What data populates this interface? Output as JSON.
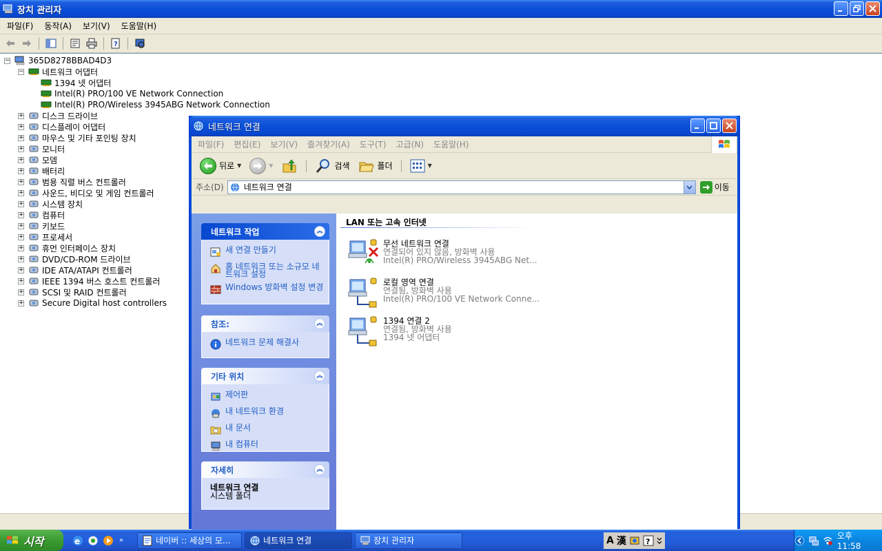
{
  "device_manager": {
    "title": "장치 관리자",
    "menu": [
      "파일(F)",
      "동작(A)",
      "보기(V)",
      "도움말(H)"
    ],
    "tree": {
      "root": "365D8278BBAD4D3",
      "network_adapters": {
        "label": "네트워크 어댑터",
        "children": [
          "1394 넷 어댑터",
          "Intel(R) PRO/100 VE Network Connection",
          "Intel(R) PRO/Wireless 3945ABG Network Connection"
        ]
      },
      "categories": [
        "디스크 드라이브",
        "디스플레이 어댑터",
        "마우스 및 기타 포인팅 장치",
        "모니터",
        "모뎀",
        "배터리",
        "범용 직렬 버스 컨트롤러",
        "사운드, 비디오 및 게임 컨트롤러",
        "시스템 장치",
        "컴퓨터",
        "키보드",
        "프로세서",
        "휴먼 인터페이스 장치",
        "DVD/CD-ROM 드라이브",
        "IDE ATA/ATAPI 컨트롤러",
        "IEEE 1394 버스 호스트 컨트롤러",
        "SCSI 및 RAID 컨트롤러",
        "Secure Digital host controllers"
      ]
    }
  },
  "network_connections": {
    "title": "네트워크 연결",
    "menu": [
      "파일(F)",
      "편집(E)",
      "보기(V)",
      "즐겨찾기(A)",
      "도구(T)",
      "고급(N)",
      "도움말(H)"
    ],
    "nav": {
      "back": "뒤로",
      "search": "검색",
      "folders": "폴더"
    },
    "address": {
      "label": "주소(D)",
      "value": "네트워크 연결",
      "go": "이동"
    },
    "taskpane": {
      "network_tasks": {
        "title": "네트워크 작업",
        "links": [
          "새 연결 만들기",
          "홈 네트워크 또는 소규모 네트워크 설정",
          "Windows 방화벽 설정 변경"
        ]
      },
      "see_also": {
        "title": "참조:",
        "links": [
          "네트워크 문제 해결사"
        ]
      },
      "other_places": {
        "title": "기타 위치",
        "links": [
          "제어판",
          "내 네트워크 환경",
          "내 문서",
          "내 컴퓨터"
        ]
      },
      "details": {
        "title": "자세히",
        "name": "네트워크 연결",
        "type": "시스템 폴더"
      }
    },
    "group_header": "LAN 또는 고속 인터넷",
    "connections": [
      {
        "name": "무선 네트워크 연결",
        "status": "연결되어 있지 않음, 방화벽 사용",
        "device": "Intel(R) PRO/Wireless 3945ABG Net..."
      },
      {
        "name": "로컬 영역 연결",
        "status": "연결됨, 방화벽 사용",
        "device": "Intel(R) PRO/100 VE Network Conne..."
      },
      {
        "name": "1394 연결 2",
        "status": "연결됨, 방화벽 사용",
        "device": "1394 넷 어댑터"
      }
    ]
  },
  "taskbar": {
    "start": "시작",
    "more": "»",
    "tasks": [
      "네이버 :: 세상의 모...",
      "네트워크 연결",
      "장치 관리자"
    ],
    "ime": [
      "A",
      "漢"
    ],
    "clock": "오후 11:58"
  }
}
